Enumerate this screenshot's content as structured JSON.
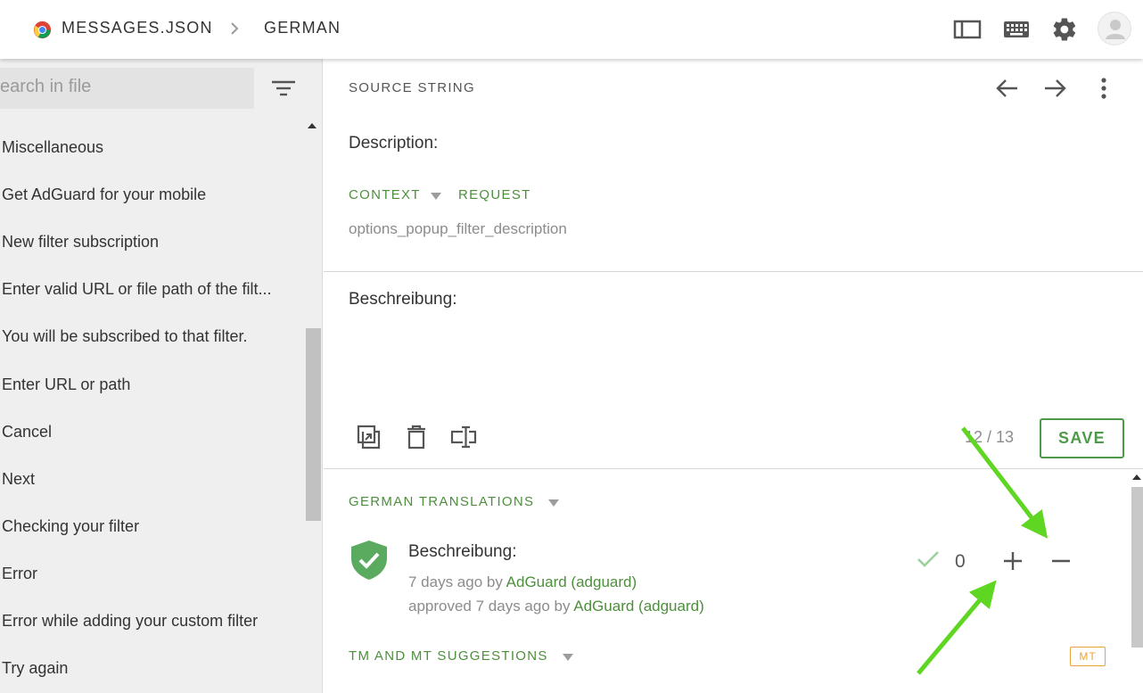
{
  "header": {
    "file_name": "MESSAGES.JSON",
    "language": "GERMAN"
  },
  "sidebar": {
    "search_placeholder": "earch in file",
    "items": [
      {
        "label": "Miscellaneous"
      },
      {
        "label": "Get AdGuard for your mobile"
      },
      {
        "label": "New filter subscription"
      },
      {
        "label": "Enter valid URL or file path of the filt..."
      },
      {
        "label": "You will be subscribed to that filter."
      },
      {
        "label": "Enter URL or path"
      },
      {
        "label": "Cancel"
      },
      {
        "label": "Next"
      },
      {
        "label": "Checking your filter"
      },
      {
        "label": "Error"
      },
      {
        "label": "Error while adding your custom filter"
      },
      {
        "label": "Try again"
      }
    ]
  },
  "source": {
    "label": "SOURCE STRING",
    "text": "Description:",
    "context_label": "CONTEXT",
    "request_label": "REQUEST",
    "key": "options_popup_filter_description"
  },
  "editor": {
    "translation": "Beschreibung:",
    "counter": "12 / 13",
    "save_label": "SAVE"
  },
  "translations": {
    "section_title": "GERMAN TRANSLATIONS",
    "items": [
      {
        "text": "Beschreibung:",
        "meta1_prefix": "7 days ago by",
        "meta1_user": "AdGuard (adguard)",
        "meta2_prefix": "approved 7 days ago by",
        "meta2_user": "AdGuard (adguard)",
        "votes": "0"
      }
    ]
  },
  "suggestions": {
    "section_title": "TM AND MT SUGGESTIONS",
    "badge": "MT"
  },
  "colors": {
    "accent_green": "#4d9a4a",
    "badge_orange": "#e8a23a",
    "annotation_arrow": "#5ed622"
  }
}
